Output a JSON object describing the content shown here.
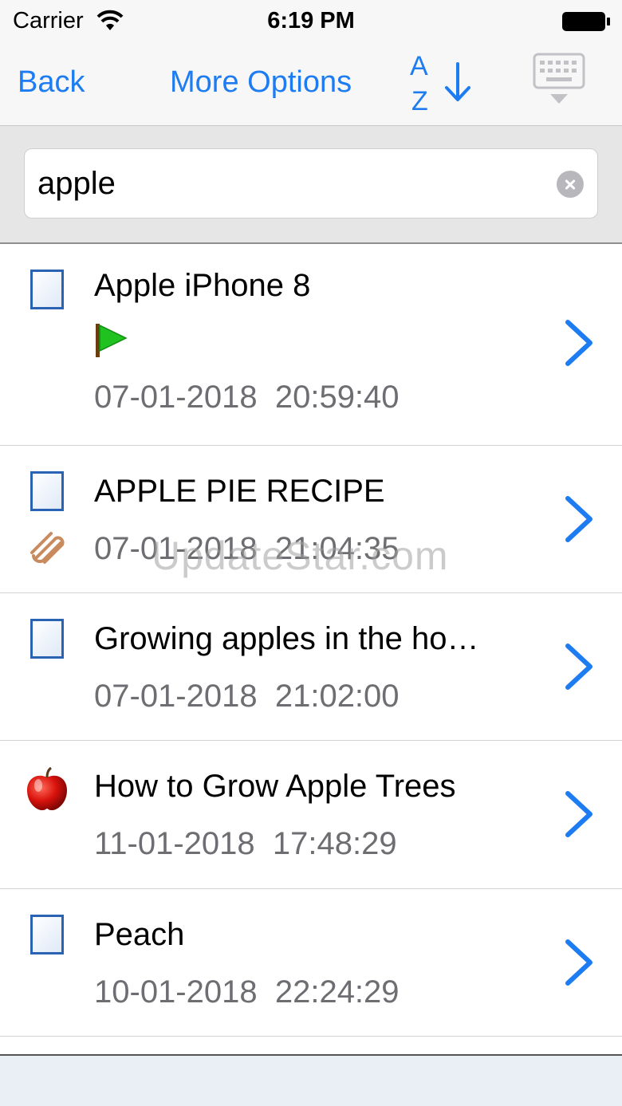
{
  "status_bar": {
    "carrier": "Carrier",
    "time": "6:19 PM"
  },
  "nav": {
    "back_label": "Back",
    "more_options_label": "More Options",
    "sort_icon": "sort-az-down-icon",
    "keyboard_icon": "keyboard-hide-icon"
  },
  "search": {
    "value": "apple"
  },
  "notes": [
    {
      "icon": "document-icon",
      "title": "Apple iPhone 8",
      "flag": "green-flag-icon",
      "date": "07-01-2018  20:59:40"
    },
    {
      "icon": "document-icon",
      "title": "APPLE PIE RECIPE",
      "attachment": "paperclip-icon",
      "date": "07-01-2018  21:04:35"
    },
    {
      "icon": "document-icon",
      "title": "Growing apples in the ho…",
      "date": "07-01-2018  21:02:00"
    },
    {
      "icon": "apple-icon",
      "title": "How to Grow Apple Trees",
      "date": "11-01-2018  17:48:29"
    },
    {
      "icon": "document-icon",
      "title": "Peach",
      "date": "10-01-2018  22:24:29"
    }
  ],
  "watermark": "UpdateStar.com",
  "colors": {
    "accent": "#1e7cf2",
    "secondary_text": "#6d6d72"
  }
}
